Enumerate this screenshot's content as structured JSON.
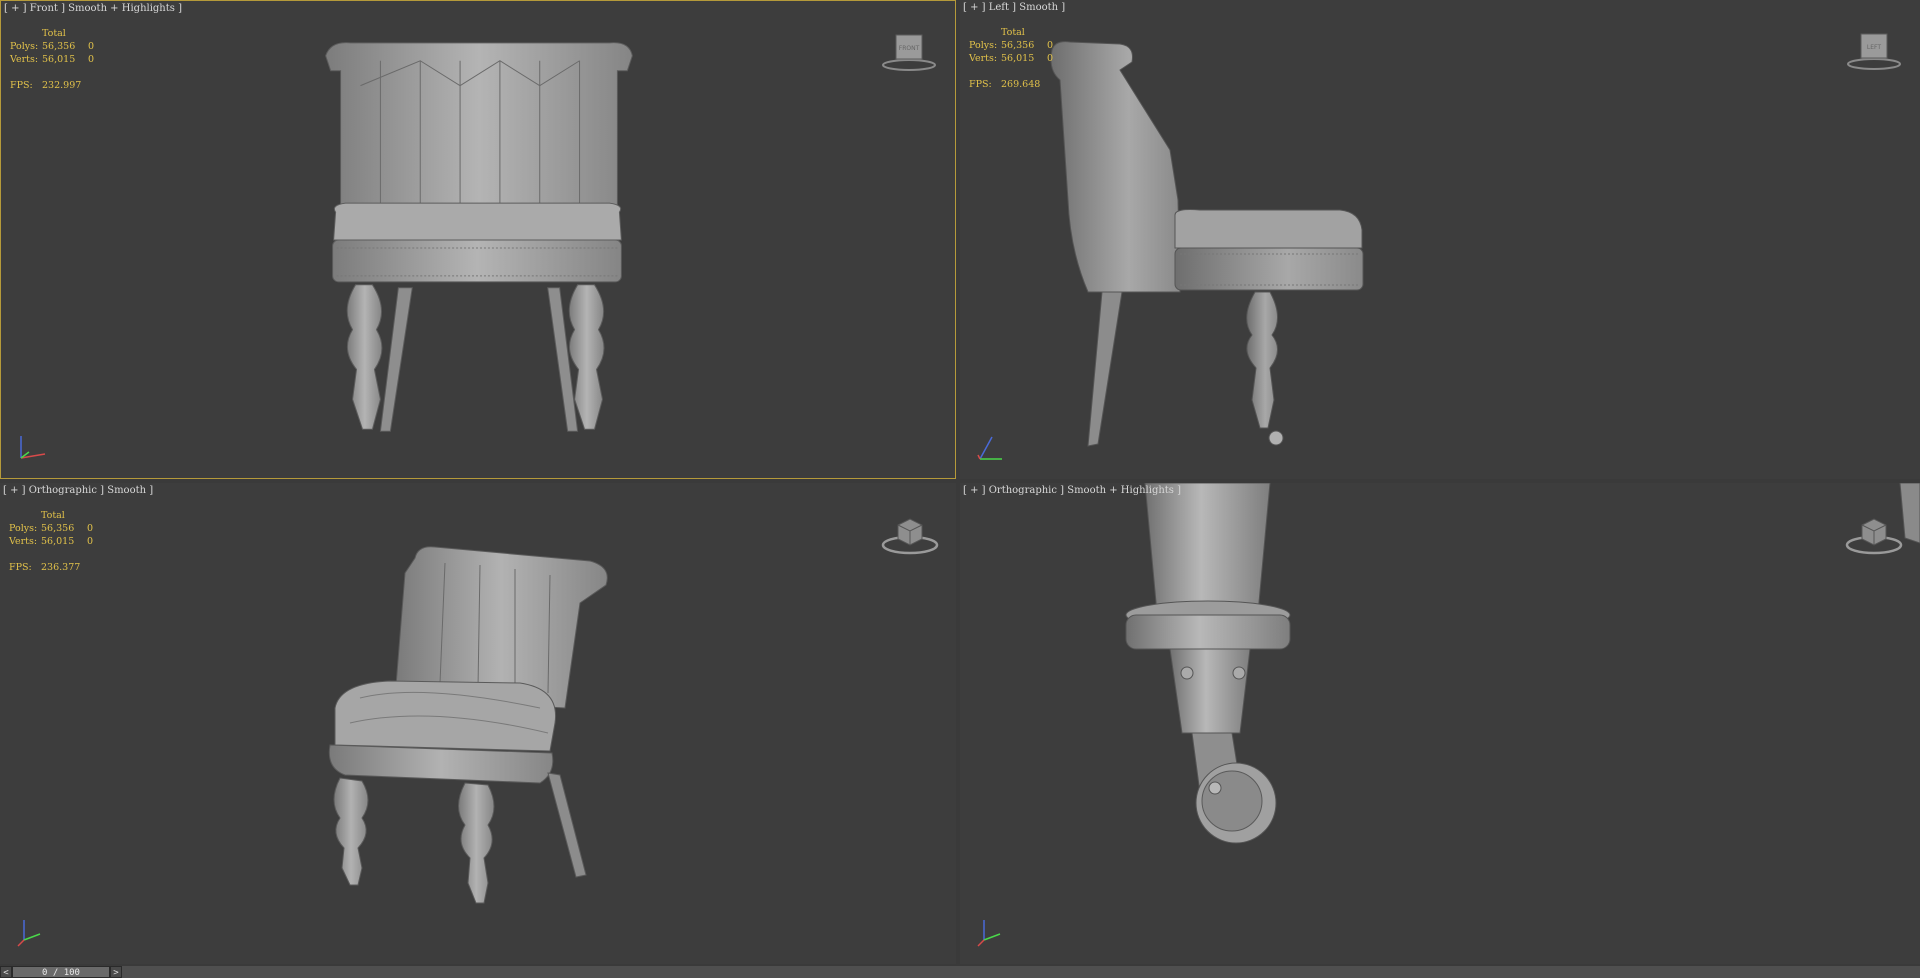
{
  "viewports": {
    "front": {
      "label": "[ + ] Front ] Smooth + Highlights ]",
      "total": "Total",
      "polys_label": "Polys:",
      "polys": "56,356",
      "polys_sel": "0",
      "verts_label": "Verts:",
      "verts": "56,015",
      "verts_sel": "0",
      "fps_label": "FPS:",
      "fps": "232.997",
      "cube_face": "FRONT",
      "active": true
    },
    "left": {
      "label": "[ + ] Left ] Smooth ]",
      "total": "Total",
      "polys_label": "Polys:",
      "polys": "56,356",
      "polys_sel": "0",
      "verts_label": "Verts:",
      "verts": "56,015",
      "verts_sel": "0",
      "fps_label": "FPS:",
      "fps": "269.648",
      "cube_face": "LEFT"
    },
    "ortho": {
      "label": "[ + ] Orthographic ] Smooth ]",
      "total": "Total",
      "polys_label": "Polys:",
      "polys": "56,356",
      "polys_sel": "0",
      "verts_label": "Verts:",
      "verts": "56,015",
      "verts_sel": "0",
      "fps_label": "FPS:",
      "fps": "236.377"
    },
    "detail": {
      "label": "[ + ] Orthographic ] Smooth + Highlights ]"
    }
  },
  "timeline": {
    "frame": "0 / 100",
    "prev_glyph": "<",
    "next_glyph": ">"
  },
  "colors": {
    "viewport_bg": "#3d3d3d",
    "active_border": "#b59a3a",
    "stats_text": "#e2c24a",
    "model_gray": "#9a9a9a"
  },
  "icons": [
    "viewcube-icon",
    "axis-tripod-icon",
    "chair-model",
    "caster-wheel-model"
  ]
}
